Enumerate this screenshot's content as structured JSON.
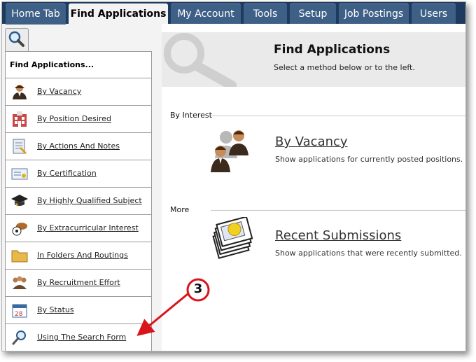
{
  "tabs": [
    {
      "label": "Home Tab"
    },
    {
      "label": "Find Applications"
    },
    {
      "label": "My Account"
    },
    {
      "label": "Tools"
    },
    {
      "label": "Setup"
    },
    {
      "label": "Job Postings"
    },
    {
      "label": "Users"
    }
  ],
  "sidebar": {
    "title": "Find Applications...",
    "search_icon": "magnifier-icon",
    "items": [
      {
        "label": "By Vacancy",
        "icon": "person-icon"
      },
      {
        "label": "By Position Desired",
        "icon": "building-icon"
      },
      {
        "label": "By Actions And Notes",
        "icon": "notes-icon"
      },
      {
        "label": "By Certification",
        "icon": "certificate-icon"
      },
      {
        "label": "By Highly Qualified Subject",
        "icon": "graduation-cap-icon"
      },
      {
        "label": "By Extracurricular Interest",
        "icon": "sports-balls-icon"
      },
      {
        "label": "In Folders And Routings",
        "icon": "folder-icon"
      },
      {
        "label": "By Recruitment Effort",
        "icon": "group-icon"
      },
      {
        "label": "By Status",
        "icon": "calendar-icon"
      },
      {
        "label": "Using The Search Form",
        "icon": "search-icon"
      }
    ]
  },
  "main": {
    "title": "Find Applications",
    "subtitle": "Select a method below or to the left.",
    "sections": [
      {
        "label": "By Interest",
        "option_title": "By Vacancy",
        "option_desc": "Show applications for currently posted positions.",
        "icon": "people-icon"
      },
      {
        "label": "More",
        "option_title": "Recent Submissions",
        "option_desc": "Show applications that were recently submitted.",
        "icon": "documents-stack-icon"
      }
    ]
  },
  "callout": {
    "number": "3"
  },
  "colors": {
    "tabbar": "#1e3a5f",
    "tab": "#3e5f86",
    "callout": "#d9141b"
  }
}
